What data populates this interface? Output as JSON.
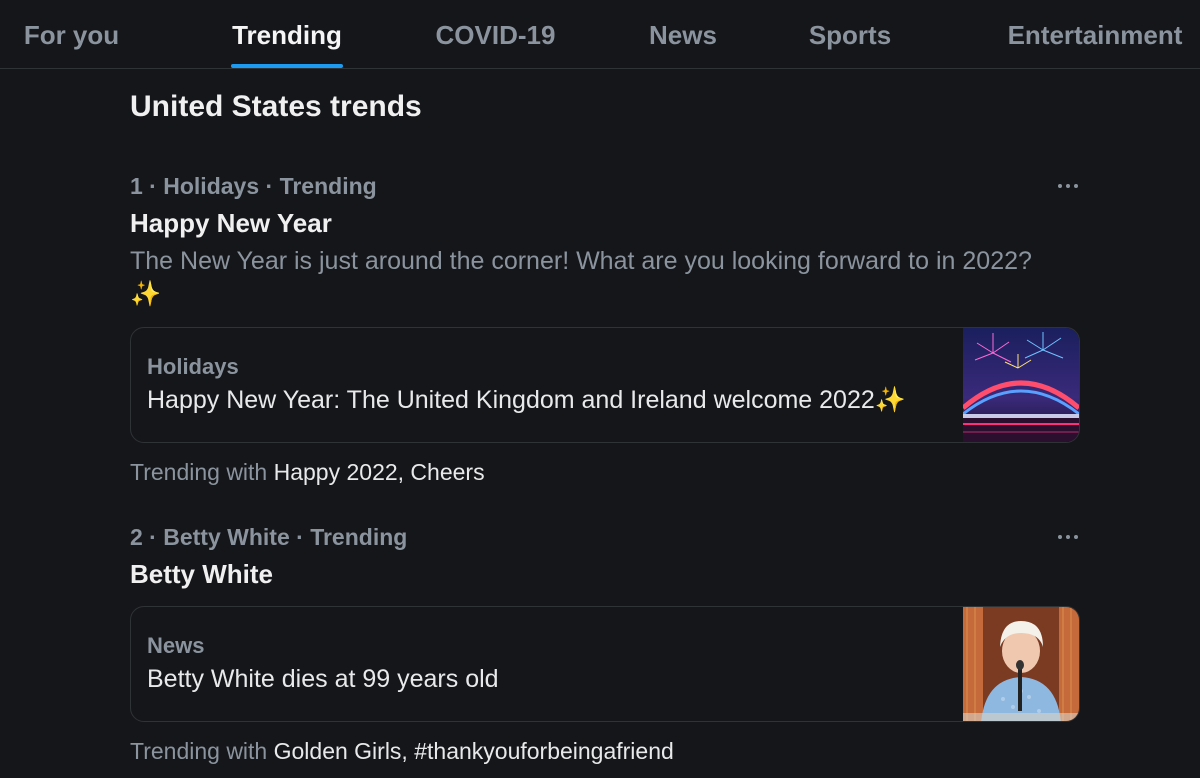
{
  "tabs": [
    {
      "label": "For you"
    },
    {
      "label": "Trending"
    },
    {
      "label": "COVID-19"
    },
    {
      "label": "News"
    },
    {
      "label": "Sports"
    },
    {
      "label": "Entertainment"
    }
  ],
  "active_tab": "Trending",
  "section_title": "United States trends",
  "trends": [
    {
      "rank": "1",
      "category": "Holidays",
      "status": "Trending",
      "title": "Happy New Year",
      "description": "The New Year is just around the corner! What are you looking forward to in 2022?",
      "description_emoji": "✨",
      "card": {
        "label": "Holidays",
        "headline": "Happy New Year: The United Kingdom and Ireland welcome 2022",
        "headline_emoji": "✨"
      },
      "trending_with_label": "Trending with",
      "trending_with_tags": "Happy 2022, Cheers"
    },
    {
      "rank": "2",
      "category": "Betty White",
      "status": "Trending",
      "title": "Betty White",
      "card": {
        "label": "News",
        "headline": "Betty White dies at 99 years old"
      },
      "trending_with_label": "Trending with",
      "trending_with_tags": "Golden Girls, #thankyouforbeingafriend"
    }
  ],
  "colors": {
    "background": "#15161a",
    "accent": "#1d9bf0",
    "muted_text": "#8b949e",
    "primary_text": "#e7e9ea",
    "border": "#2f3336"
  }
}
